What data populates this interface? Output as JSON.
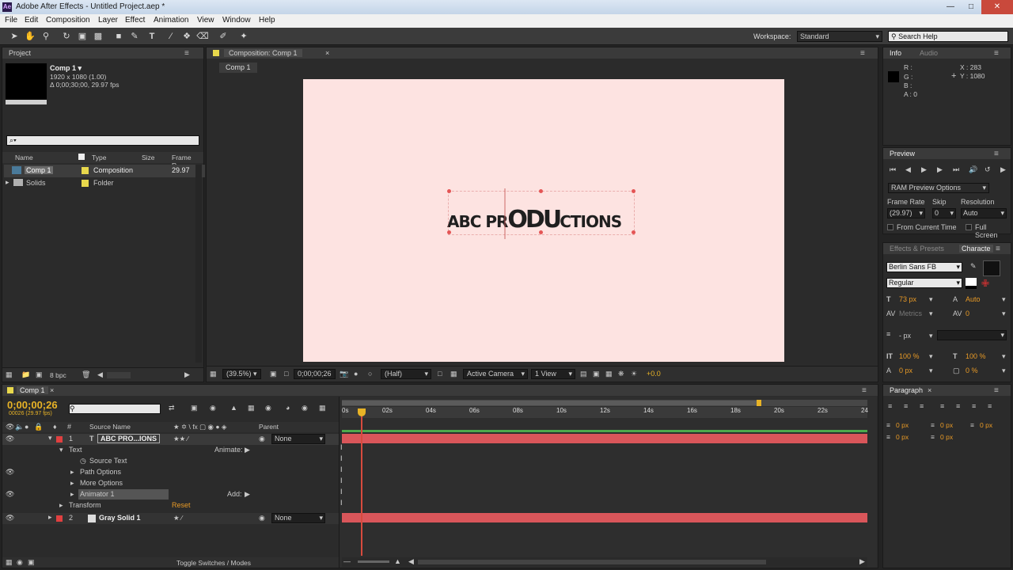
{
  "window": {
    "title": "Adobe After Effects - Untitled Project.aep *",
    "app_icon": "Ae"
  },
  "menu": [
    "File",
    "Edit",
    "Composition",
    "Layer",
    "Effect",
    "Animation",
    "View",
    "Window",
    "Help"
  ],
  "toolbar": {
    "workspace_label": "Workspace:",
    "workspace_value": "Standard",
    "search_help": "Search Help"
  },
  "project": {
    "tab": "Project",
    "comp_name": "Comp 1 ▾",
    "comp_size": "1920 x 1080 (1.00)",
    "comp_duration": "Δ 0;00;30;00, 29.97 fps",
    "search_placeholder": "⌕▾",
    "columns": {
      "name": "Name",
      "type": "Type",
      "size": "Size",
      "frame_rate": "Frame R..."
    },
    "items": [
      {
        "name": "Comp 1",
        "type": "Composition",
        "frame_rate": "29.97",
        "color": "#e8d84c"
      },
      {
        "name": "Solids",
        "type": "Folder",
        "frame_rate": "",
        "color": "#e8d84c"
      }
    ],
    "bpc": "8 bpc"
  },
  "composition": {
    "tab": "Composition: Comp 1",
    "breadcrumb": "Comp 1",
    "canvas_bg": "#fde3e1",
    "text_left": "ABC PR",
    "text_logo": "ODU",
    "text_right": "CTIONS",
    "zoom": "(39.5%)",
    "timecode": "0;00;00;26",
    "resolution": "(Half)",
    "camera": "Active Camera",
    "view": "1 View",
    "offset": "+0.0"
  },
  "info": {
    "tab": "Info",
    "tab2": "Audio",
    "r": "R :",
    "g": "G :",
    "b": "B :",
    "a": "A : 0",
    "x": "X : 283",
    "y": "Y : 1080"
  },
  "preview": {
    "tab": "Preview",
    "ram_options": "RAM Preview Options",
    "frame_rate_label": "Frame Rate",
    "skip_label": "Skip",
    "resolution_label": "Resolution",
    "frame_rate": "(29.97)",
    "skip": "0",
    "resolution": "Auto",
    "from_current": "From Current Time",
    "full_screen": "Full Screen"
  },
  "character": {
    "tab1": "Effects & Presets",
    "tab2": "Characte",
    "font": "Berlin Sans FB",
    "style": "Regular",
    "size": "73 px",
    "leading": "Auto",
    "kerning": "Metrics",
    "tracking": "0",
    "stroke": "- px",
    "vscale": "100 %",
    "hscale": "100 %",
    "baseline": "0 px",
    "tsume": "0 %"
  },
  "paragraph": {
    "tab": "Paragraph",
    "indent_left": "0 px",
    "indent_right": "0 px",
    "indent_first": "0 px",
    "space_before": "0 px",
    "space_after": "0 px"
  },
  "timeline": {
    "tab": "Comp 1",
    "timecode": "0;00;00;26",
    "frame_info": "00026 (29.97 fps)",
    "columns": {
      "source": "Source Name",
      "parent": "Parent"
    },
    "ruler": [
      "0s",
      "02s",
      "04s",
      "06s",
      "08s",
      "10s",
      "12s",
      "14s",
      "16s",
      "18s",
      "20s",
      "22s",
      "24"
    ],
    "layers": [
      {
        "num": "1",
        "name": "ABC PRO...IONS",
        "parent": "None",
        "color": "#e04040"
      },
      {
        "num": "2",
        "name": "Gray Solid 1",
        "parent": "None",
        "color": "#e04040"
      }
    ],
    "props": {
      "text": "Text",
      "animate": "Animate:",
      "source_text": "Source Text",
      "path_options": "Path Options",
      "more_options": "More Options",
      "animator": "Animator 1",
      "add": "Add:",
      "transform": "Transform",
      "reset": "Reset"
    },
    "toggle": "Toggle Switches / Modes"
  }
}
